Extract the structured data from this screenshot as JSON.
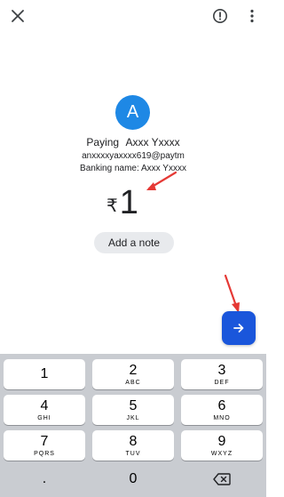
{
  "header": {
    "close_icon": "close-icon",
    "alert_icon": "report-icon",
    "more_icon": "more-vert-icon"
  },
  "payee": {
    "avatar_letter": "A",
    "avatar_color": "#1e88e5",
    "paying_label": "Paying",
    "name": "Axxx Yxxxx",
    "upi_id": "anxxxxyaxxxx619@paytm",
    "banking_name_label": "Banking name:",
    "banking_name": "Axxx Yxxxx"
  },
  "amount": {
    "currency": "₹",
    "value": "1"
  },
  "note": {
    "label": "Add a note"
  },
  "fab": {
    "icon": "arrow-right-icon",
    "color": "#1a56db"
  },
  "keypad": {
    "keys": [
      {
        "num": "1",
        "letters": ""
      },
      {
        "num": "2",
        "letters": "ABC"
      },
      {
        "num": "3",
        "letters": "DEF"
      },
      {
        "num": "4",
        "letters": "GHI"
      },
      {
        "num": "5",
        "letters": "JKL"
      },
      {
        "num": "6",
        "letters": "MNO"
      },
      {
        "num": "7",
        "letters": "PQRS"
      },
      {
        "num": "8",
        "letters": "TUV"
      },
      {
        "num": "9",
        "letters": "WXYZ"
      },
      {
        "num": ".",
        "letters": ""
      },
      {
        "num": "0",
        "letters": ""
      },
      {
        "num": "",
        "letters": ""
      }
    ],
    "backspace_icon": "backspace-icon"
  },
  "annotations": {
    "arrow_color": "#e53935"
  }
}
